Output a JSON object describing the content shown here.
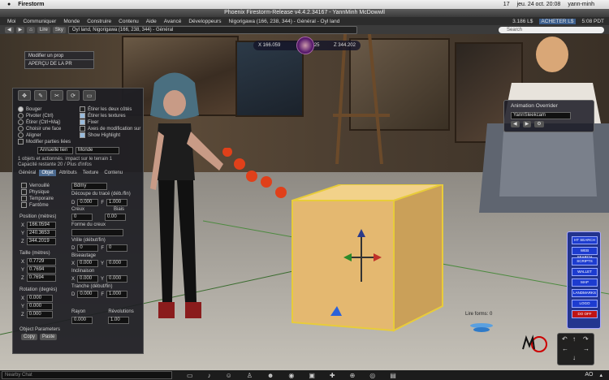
{
  "mac_menu": {
    "apple": "",
    "app": "Firestorm",
    "right_status": "jeu. 24 oct. 20:08",
    "user": "yann-minh",
    "battery": "17"
  },
  "window_title": "Phoenix Firestorm-Release v4.4.2.34167 - YannMinh McDowwll",
  "menu": {
    "items": [
      "Moi",
      "Communiquer",
      "Monde",
      "Construire",
      "Contenu",
      "Aide",
      "Avancé",
      "Développeurs",
      "Nigorigawa (166, 238, 344) - Général - Oyl land"
    ],
    "right": [
      "3.186 L$",
      "ACHETER L$",
      "5:08 PDT"
    ]
  },
  "nav": {
    "buttons": [
      "◀",
      "▶",
      "⌂",
      "Lire",
      "Sky"
    ],
    "location": "Oyl land, Nigorigawa (166, 238, 344) - Général",
    "search_placeholder": "Search"
  },
  "coords": {
    "x": "X 166.059",
    "y": "25",
    "z": "Z 344.202"
  },
  "floaters": {
    "a": "Modifier un prop",
    "b": "APERÇU DE LA PR"
  },
  "build": {
    "tools": [
      "✥",
      "✎",
      "✂",
      "⟳",
      "▭"
    ],
    "radios": [
      {
        "label": "Bouger",
        "on": true
      },
      {
        "label": "Pivoter (Ctrl)",
        "on": false
      },
      {
        "label": "Étirer (Ctrl+Maj)",
        "on": false
      },
      {
        "label": "Choisir une face",
        "on": false
      },
      {
        "label": "Aligner",
        "on": false
      }
    ],
    "modify_linked": "Modifier parties liées",
    "checks": [
      {
        "label": "Étirer les deux côtés",
        "on": false
      },
      {
        "label": "Étirer les textures",
        "on": true
      },
      {
        "label": "Fixer",
        "on": true
      },
      {
        "label": "Axes de modification sur",
        "on": false
      },
      {
        "label": "Show Highlight",
        "on": true
      }
    ],
    "ruler_label": "Annuelle lien",
    "ruler_value": "Monde",
    "info_line1": "1 objets et actionnés. impact sur le terrain 1",
    "info_line2": "Capacité restante 20 / Plus d'infos",
    "tabs": [
      {
        "label": "Général",
        "on": false
      },
      {
        "label": "Objet",
        "on": true
      },
      {
        "label": "Attributs",
        "on": false
      },
      {
        "label": "Texture",
        "on": false
      },
      {
        "label": "Contenu",
        "on": false
      }
    ],
    "obj_checks": [
      {
        "label": "Verrouillé",
        "on": false
      },
      {
        "label": "Physique",
        "on": false
      },
      {
        "label": "Temporaire",
        "on": false
      },
      {
        "label": "Fantôme",
        "on": false
      }
    ],
    "position_label": "Position (mètres)",
    "position": [
      "166.0594",
      "240.3653",
      "344.2019"
    ],
    "size_label": "Taille (mètres)",
    "size": [
      "0.7729",
      "0.7694",
      "0.7694"
    ],
    "rotation_label": "Rotation (degrés)",
    "rotation": [
      "0.000",
      "0.000",
      "0.000"
    ],
    "building_block": "Bdmy",
    "path_cut_label": "Découpe du tracé (déb./fin)",
    "path_cut": [
      "0.000",
      "1.000"
    ],
    "hollow_label": "Creux",
    "hollow": "0",
    "skew_label": "Biais",
    "skew": "0.00",
    "hollow_shape_label": "Forme du creux",
    "hollow_shape": "",
    "twist_label": "Vrille (début/fin)",
    "twist": [
      "0",
      "0"
    ],
    "taper_label": "Biseautage",
    "taper": [
      "0.000",
      "0.000"
    ],
    "slope_label": "Inclinaison",
    "slope": [
      "0.000",
      "0.000"
    ],
    "slice_label": "Tranche (début/fin)",
    "slice": [
      "0.000",
      "1.000"
    ],
    "radius_label": "Rayon",
    "radius": "0.000",
    "revolutions_label": "Révolutions",
    "revolutions": "1.00",
    "obj_params": "Object Parameters",
    "copy": "Copy",
    "paste": "Paste"
  },
  "ao": {
    "title": "Animation Overrider",
    "selected": "YannSleekcam"
  },
  "blue_hud": {
    "buttons": [
      "HT SEARCH",
      "WEB SEARCH",
      "SCRIPTS",
      "WALLET",
      "MAP",
      "LANDMARKS",
      "LOGO",
      "DO OFF"
    ]
  },
  "floor_label": "Lire forms: 0",
  "chat": {
    "placeholder": "Nearby Chat"
  },
  "bottom_icons": [
    "talk",
    "speak",
    "gestures",
    "people",
    "places",
    "look",
    "camera",
    "inventory",
    "map",
    "mini-map",
    "snapshot",
    "search",
    "AO"
  ],
  "bottom_right": [
    "AO",
    "▴"
  ]
}
